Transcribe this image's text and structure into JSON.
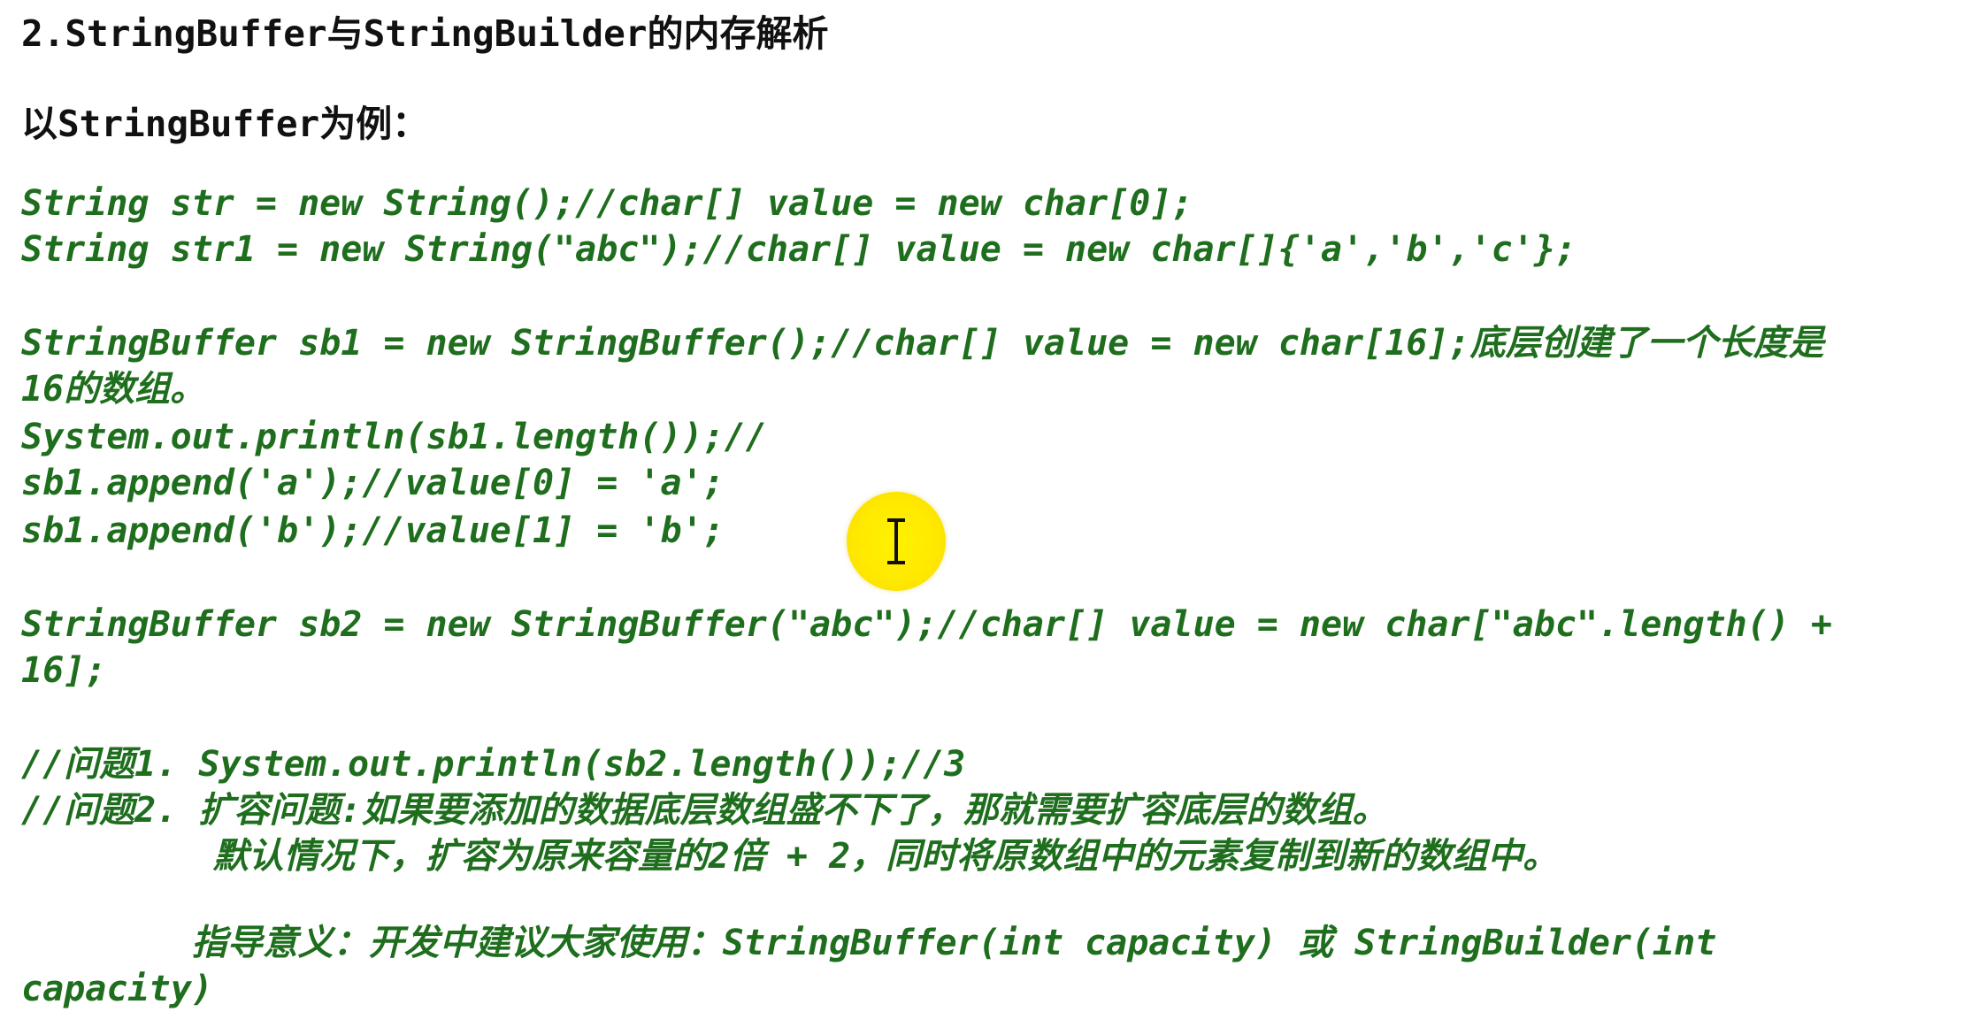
{
  "heading": {
    "title": "2.StringBuffer与StringBuilder的内存解析",
    "subtitle": "以StringBuffer为例："
  },
  "code": {
    "l1": "String str = new String();//char[] value = new char[0];",
    "l2": "String str1 = new String(\"abc\");//char[] value = new char[]{'a','b','c'};",
    "l3": "StringBuffer sb1 = new StringBuffer();//char[] value = new char[16];底层创建了一个长度是",
    "l4": "16的数组。",
    "l5": "System.out.println(sb1.length());//",
    "l6": "sb1.append('a');//value[0] = 'a';",
    "l7": "sb1.append('b');//value[1] = 'b';",
    "l8": "StringBuffer sb2 = new StringBuffer(\"abc\");//char[] value = new char[\"abc\".length() +",
    "l9": "16];",
    "l10": "//问题1. System.out.println(sb2.length());//3",
    "l11": "//问题2. 扩容问题:如果要添加的数据底层数组盛不下了，那就需要扩容底层的数组。",
    "l12": "         默认情况下，扩容为原来容量的2倍 + 2，同时将原数组中的元素复制到新的数组中。",
    "l13": "        指导意义：开发中建议大家使用：StringBuffer(int capacity) 或 StringBuilder(int",
    "l14": "capacity)"
  },
  "colors": {
    "code": "#1e6e1e",
    "heading": "#111111",
    "cursor_highlight": "#fff200"
  },
  "icons": {
    "cursor": "text-ibeam-cursor-icon"
  }
}
